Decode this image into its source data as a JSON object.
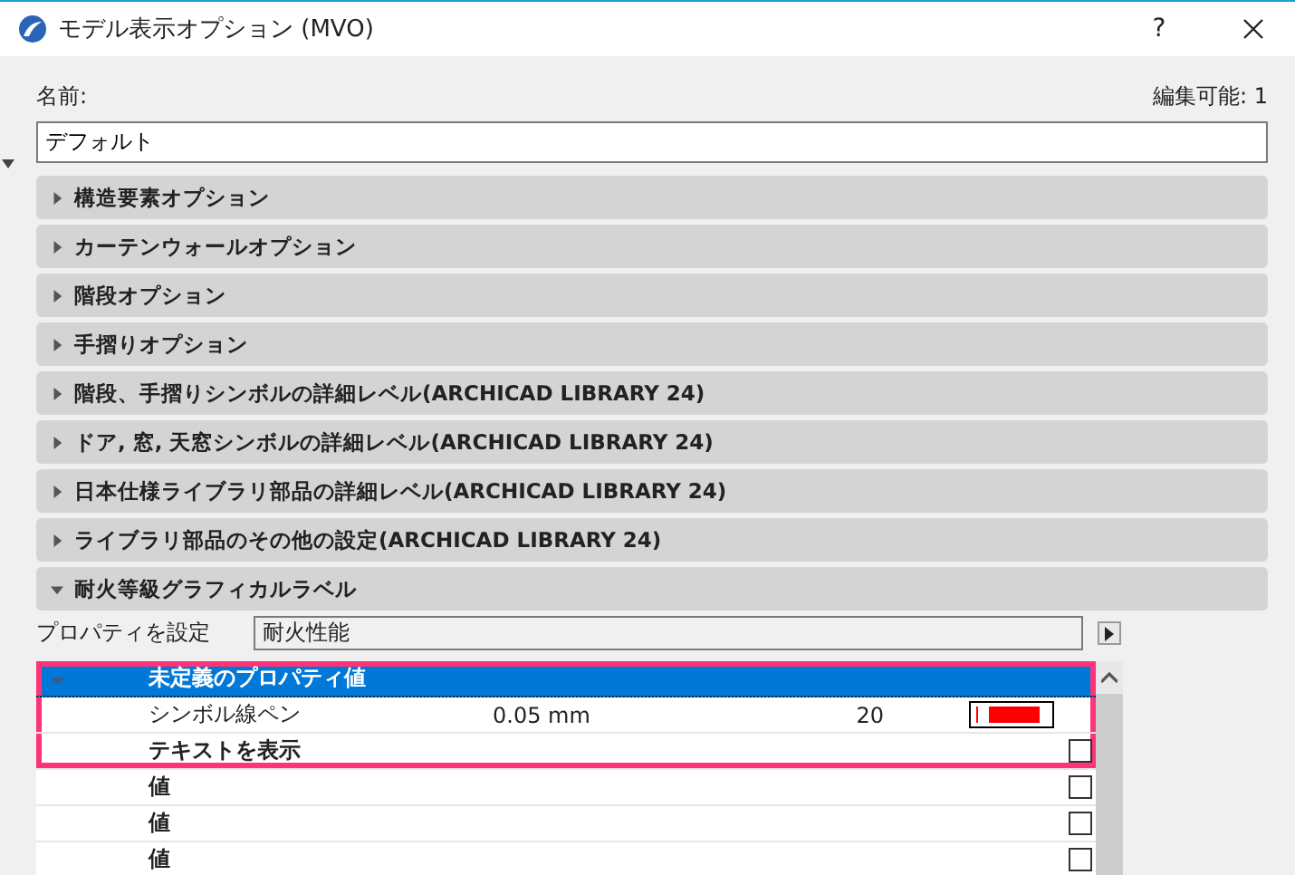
{
  "window": {
    "title": "モデル表示オプション (MVO)",
    "help": "?"
  },
  "name_label": "名前:",
  "editable": "編集可能: 1",
  "name_value": "デフォルト",
  "sections": [
    {
      "label": "構造要素オプション",
      "expanded": false
    },
    {
      "label": "カーテンウォールオプション",
      "expanded": false
    },
    {
      "label": "階段オプション",
      "expanded": false
    },
    {
      "label": "手摺りオプション",
      "expanded": false
    },
    {
      "label": "階段、手摺りシンボルの詳細レベル(ARCHICAD LIBRARY 24)",
      "expanded": false
    },
    {
      "label": "ドア, 窓, 天窓シンボルの詳細レベル(ARCHICAD LIBRARY 24)",
      "expanded": false
    },
    {
      "label": "日本仕様ライブラリ部品の詳細レベル(ARCHICAD LIBRARY 24)",
      "expanded": false
    },
    {
      "label": "ライブラリ部品のその他の設定(ARCHICAD LIBRARY 24)",
      "expanded": false
    },
    {
      "label": "耐火等級グラフィカルラベル",
      "expanded": true
    }
  ],
  "property": {
    "label": "プロパティを設定",
    "value": "耐火性能"
  },
  "rows": [
    {
      "kind": "header",
      "label": "未定義のプロパティ値",
      "expanded": true,
      "selected": true,
      "highlighted": true
    },
    {
      "kind": "pen",
      "label": "シンボル線ペン",
      "value": "0.05 mm",
      "number": "20",
      "color": "#ff0000",
      "selected": false,
      "highlighted": true
    },
    {
      "kind": "check",
      "label": "テキストを表示",
      "checked": false,
      "selected": false,
      "highlighted": true
    },
    {
      "kind": "check",
      "label": "値",
      "checked": false,
      "selected": false,
      "highlighted": false
    },
    {
      "kind": "check",
      "label": "値",
      "checked": false,
      "selected": false,
      "highlighted": false
    },
    {
      "kind": "check",
      "label": "値",
      "checked": false,
      "selected": false,
      "highlighted": false
    }
  ]
}
